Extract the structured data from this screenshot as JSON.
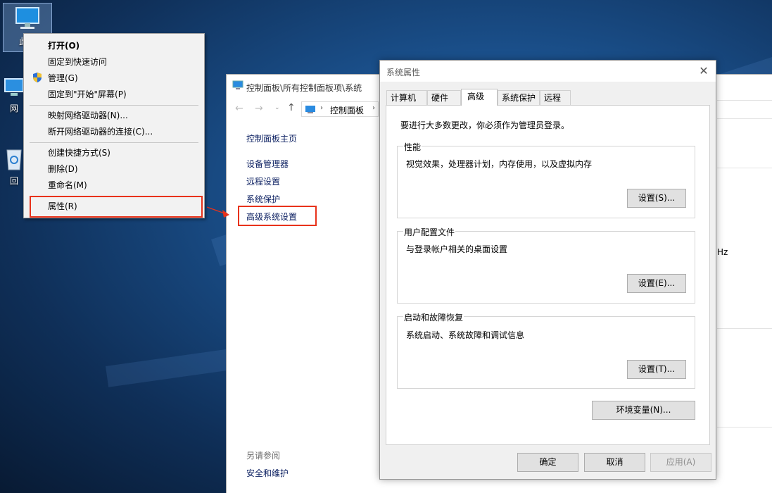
{
  "desktop": {
    "icons": [
      {
        "label": "此电",
        "icon": "computer-icon"
      },
      {
        "label": "网",
        "icon": "network-icon"
      },
      {
        "label": "回",
        "icon": "recycle-bin-icon"
      }
    ]
  },
  "context_menu": {
    "groups": [
      [
        {
          "label": "打开(O)",
          "bold": true
        },
        {
          "label": "固定到快速访问"
        },
        {
          "label": "管理(G)",
          "icon": "uac-shield-icon"
        },
        {
          "label": "固定到\"开始\"屏幕(P)"
        }
      ],
      [
        {
          "label": "映射网络驱动器(N)..."
        },
        {
          "label": "断开网络驱动器的连接(C)..."
        }
      ],
      [
        {
          "label": "创建快捷方式(S)"
        },
        {
          "label": "删除(D)"
        },
        {
          "label": "重命名(M)"
        }
      ],
      [
        {
          "label": "属性(R)",
          "highlighted": true
        }
      ]
    ]
  },
  "control_panel": {
    "title": "控制面板\\所有控制面板项\\系统",
    "breadcrumb": "控制面板",
    "nav": {
      "home": "控制面板主页",
      "links": [
        "设备管理器",
        "远程设置",
        "系统保护",
        "高级系统设置"
      ],
      "highlighted": "高级系统设置"
    },
    "see_also_label": "另请参阅",
    "see_also_link": "安全和维护",
    "partial_text": "Hz"
  },
  "dialog": {
    "title": "系统属性",
    "tabs": [
      "计算机名",
      "硬件",
      "高级",
      "系统保护",
      "远程"
    ],
    "active_tab": "高级",
    "notice": "要进行大多数更改，你必须作为管理员登录。",
    "groups": [
      {
        "label": "性能",
        "desc": "视觉效果，处理器计划，内存使用，以及虚拟内存",
        "button": "设置(S)..."
      },
      {
        "label": "用户配置文件",
        "desc": "与登录帐户相关的桌面设置",
        "button": "设置(E)..."
      },
      {
        "label": "启动和故障恢复",
        "desc": "系统启动、系统故障和调试信息",
        "button": "设置(T)..."
      }
    ],
    "env_button": "环境变量(N)...",
    "ok": "确定",
    "cancel": "取消",
    "apply": "应用(A)"
  },
  "colors": {
    "highlight_box": "#e8321b",
    "link": "#0a1e60"
  }
}
